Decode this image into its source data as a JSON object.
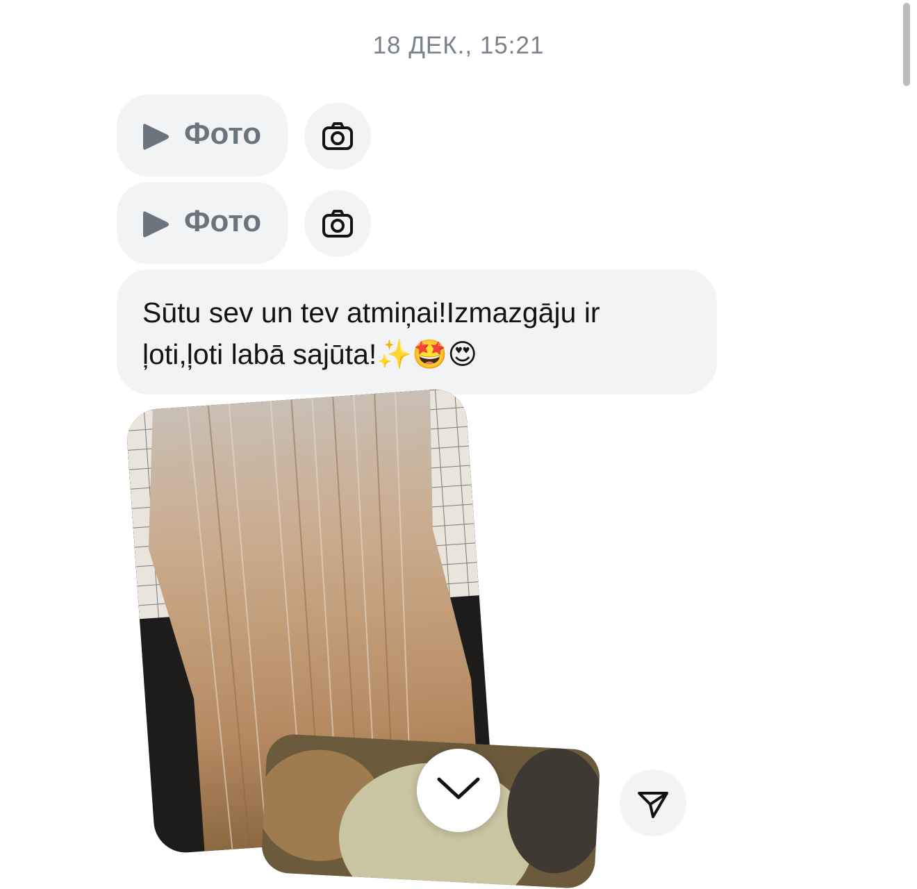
{
  "timestamp": "18 ДЕК., 15:21",
  "messages": [
    {
      "type": "photo-pill",
      "label": "Фото"
    },
    {
      "type": "photo-pill",
      "label": "Фото"
    }
  ],
  "text_message": {
    "line1": "Sūtu sev un tev atmiņai!Izmazgāju ir",
    "line2": "ļoti,ļoti labā sajūta!✨🤩😍"
  },
  "icons": {
    "play": "play-icon",
    "camera": "camera-icon",
    "chevron": "chevron-down-icon",
    "send": "send-icon"
  },
  "colors": {
    "bubble_bg": "#f1f3f5",
    "timestamp": "#7b818a",
    "pill_label": "#6b737d",
    "text": "#111214"
  }
}
